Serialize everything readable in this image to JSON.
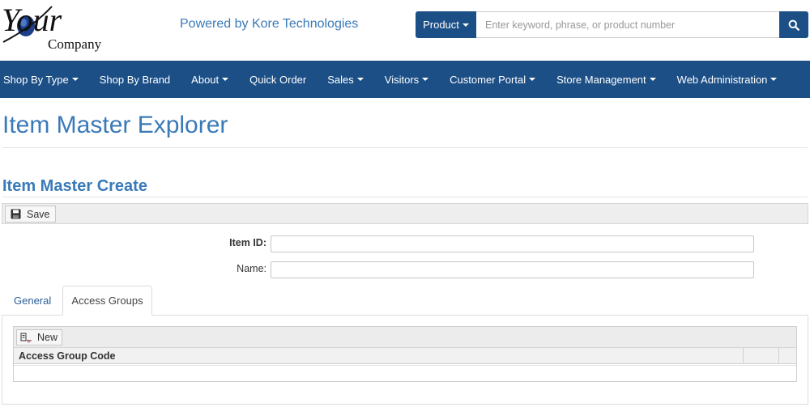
{
  "header": {
    "logo_text_main": "Your",
    "logo_text_sub": "Company",
    "tagline": "Powered by Kore Technologies",
    "search": {
      "scope_label": "Product",
      "placeholder": "Enter keyword, phrase, or product number"
    }
  },
  "nav": {
    "items": [
      {
        "label": "Shop By Type",
        "dropdown": true
      },
      {
        "label": "Shop By Brand",
        "dropdown": false
      },
      {
        "label": "About",
        "dropdown": true
      },
      {
        "label": "Quick Order",
        "dropdown": false
      },
      {
        "label": "Sales",
        "dropdown": true
      },
      {
        "label": "Visitors",
        "dropdown": true
      },
      {
        "label": "Customer Portal",
        "dropdown": true
      },
      {
        "label": "Store Management",
        "dropdown": true
      },
      {
        "label": "Web Administration",
        "dropdown": true
      }
    ]
  },
  "page": {
    "title": "Item Master Explorer",
    "section_title": "Item Master Create",
    "toolbar": {
      "save_label": "Save"
    },
    "form": {
      "item_id_label": "Item ID:",
      "item_id_value": "",
      "name_label": "Name:",
      "name_value": ""
    },
    "tabs": [
      {
        "label": "General",
        "active": false
      },
      {
        "label": "Access Groups",
        "active": true
      }
    ],
    "grid": {
      "new_label": "New",
      "columns": [
        "Access Group Code"
      ],
      "rows": []
    }
  },
  "colors": {
    "brand": "#1c4f86",
    "title": "#3a7ab8",
    "link": "#2a5f95"
  }
}
